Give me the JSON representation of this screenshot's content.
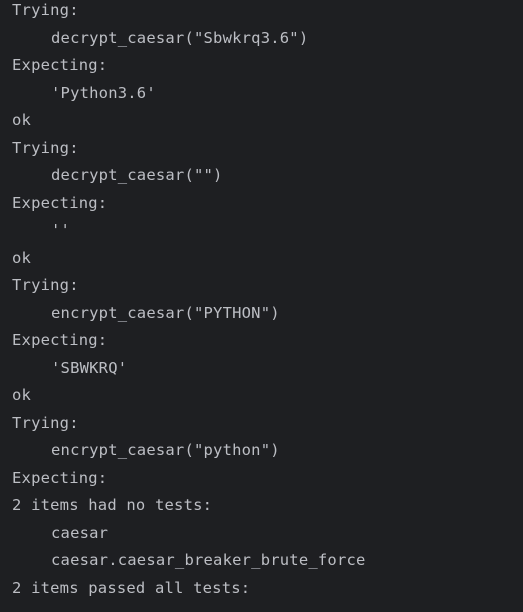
{
  "console": {
    "lines": [
      {
        "text": "Trying:",
        "indent": 0
      },
      {
        "text": "decrypt_caesar(\"Sbwkrq3.6\")",
        "indent": 1
      },
      {
        "text": "Expecting:",
        "indent": 0
      },
      {
        "text": "'Python3.6'",
        "indent": 1
      },
      {
        "text": "ok",
        "indent": 0
      },
      {
        "text": "Trying:",
        "indent": 0
      },
      {
        "text": "decrypt_caesar(\"\")",
        "indent": 1
      },
      {
        "text": "Expecting:",
        "indent": 0
      },
      {
        "text": "''",
        "indent": 1
      },
      {
        "text": "ok",
        "indent": 0
      },
      {
        "text": "Trying:",
        "indent": 0
      },
      {
        "text": "encrypt_caesar(\"PYTHON\")",
        "indent": 1
      },
      {
        "text": "Expecting:",
        "indent": 0
      },
      {
        "text": "'SBWKRQ'",
        "indent": 1
      },
      {
        "text": "ok",
        "indent": 0
      },
      {
        "text": "Trying:",
        "indent": 0
      },
      {
        "text": "encrypt_caesar(\"python\")",
        "indent": 1
      },
      {
        "text": "Expecting:",
        "indent": 0
      },
      {
        "text": "2 items had no tests:",
        "indent": 0
      },
      {
        "text": "caesar",
        "indent": 1
      },
      {
        "text": "caesar.caesar_breaker_brute_force",
        "indent": 1
      },
      {
        "text": "2 items passed all tests:",
        "indent": 0
      }
    ]
  }
}
